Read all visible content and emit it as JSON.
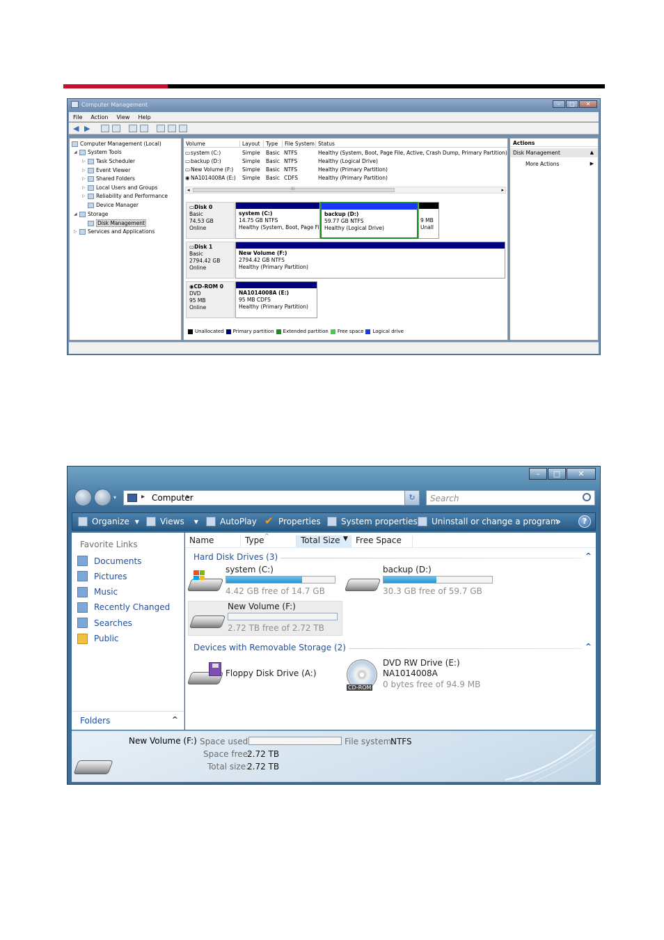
{
  "computer_management": {
    "title": "Computer Management",
    "menu": [
      "File",
      "Action",
      "View",
      "Help"
    ],
    "tree": [
      {
        "label": "Computer Management (Local)",
        "icon": "computer-icon"
      },
      {
        "label": "System Tools",
        "icon": "tools-icon"
      },
      {
        "label": "Task Scheduler",
        "icon": "clock-icon"
      },
      {
        "label": "Event Viewer",
        "icon": "event-viewer-icon"
      },
      {
        "label": "Shared Folders",
        "icon": "shared-folder-icon"
      },
      {
        "label": "Local Users and Groups",
        "icon": "users-icon"
      },
      {
        "label": "Reliability and Performance",
        "icon": "performance-icon"
      },
      {
        "label": "Device Manager",
        "icon": "device-manager-icon"
      },
      {
        "label": "Storage",
        "icon": "storage-icon"
      },
      {
        "label": "Disk Management",
        "icon": "disk-management-icon"
      },
      {
        "label": "Services and Applications",
        "icon": "services-icon"
      }
    ],
    "volume_columns": [
      "Volume",
      "Layout",
      "Type",
      "File System",
      "Status"
    ],
    "volumes": [
      {
        "volume": "system (C:)",
        "layout": "Simple",
        "type": "Basic",
        "fs": "NTFS",
        "status": "Healthy (System, Boot, Page File, Active, Crash Dump, Primary Partition)"
      },
      {
        "volume": "backup (D:)",
        "layout": "Simple",
        "type": "Basic",
        "fs": "NTFS",
        "status": "Healthy (Logical Drive)"
      },
      {
        "volume": "New Volume (F:)",
        "layout": "Simple",
        "type": "Basic",
        "fs": "NTFS",
        "status": "Healthy (Primary Partition)"
      },
      {
        "volume": "NA1014008A (E:)",
        "layout": "Simple",
        "type": "Basic",
        "fs": "CDFS",
        "status": "Healthy (Primary Partition)"
      }
    ],
    "scroll_mark": "III",
    "disks": [
      {
        "name": "Disk 0",
        "type": "Basic",
        "size": "74.53 GB",
        "state": "Online"
      },
      {
        "name": "Disk 1",
        "type": "Basic",
        "size": "2794.42 GB",
        "state": "Online"
      },
      {
        "name": "CD-ROM 0",
        "type": "DVD",
        "size": "95 MB",
        "state": "Online"
      }
    ],
    "partitions": {
      "c": {
        "name": "system  (C:)",
        "size": "14.75 GB NTFS",
        "status": "Healthy (System, Boot, Page Fi"
      },
      "d": {
        "name": "backup  (D:)",
        "size": "59.77 GB NTFS",
        "status": "Healthy (Logical Drive)"
      },
      "unalloc": {
        "size": "9 MB",
        "status": "Unall"
      },
      "f": {
        "name": "New Volume  (F:)",
        "size": "2794.42 GB NTFS",
        "status": "Healthy (Primary Partition)"
      },
      "e": {
        "name": "NA1014008A  (E:)",
        "size": "95 MB CDFS",
        "status": "Healthy (Primary Partition)"
      }
    },
    "legend": [
      {
        "label": "Unallocated",
        "color": "#000000"
      },
      {
        "label": "Primary partition",
        "color": "#00007f"
      },
      {
        "label": "Extended partition",
        "color": "#1b8f1b"
      },
      {
        "label": "Free space",
        "color": "#3fcf3f"
      },
      {
        "label": "Logical drive",
        "color": "#1b37f5"
      }
    ],
    "actions": {
      "header": "Actions",
      "selected": "Disk Management",
      "more": "More Actions"
    }
  },
  "explorer": {
    "address": "Computer",
    "search_placeholder": "Search",
    "commands": {
      "organize": "Organize",
      "views": "Views",
      "autoplay": "AutoPlay",
      "properties": "Properties",
      "system_properties": "System properties",
      "uninstall": "Uninstall or change a program",
      "more": "»"
    },
    "favorite_links_title": "Favorite Links",
    "favorites": [
      {
        "label": "Documents",
        "icon": "documents-icon"
      },
      {
        "label": "Pictures",
        "icon": "pictures-icon"
      },
      {
        "label": "Music",
        "icon": "music-icon"
      },
      {
        "label": "Recently Changed",
        "icon": "recently-changed-icon"
      },
      {
        "label": "Searches",
        "icon": "searches-icon"
      },
      {
        "label": "Public",
        "icon": "public-folder-icon"
      }
    ],
    "folders_label": "Folders",
    "columns": [
      "Name",
      "Type",
      "Total Size",
      "Free Space"
    ],
    "group_hdd": "Hard Disk Drives (3)",
    "group_removable": "Devices with Removable Storage (2)",
    "drives": {
      "c": {
        "name": "system (C:)",
        "free": "4.42 GB free of 14.7 GB",
        "used_fraction": 0.7
      },
      "d": {
        "name": "backup (D:)",
        "free": "30.3 GB free of 59.7 GB",
        "used_fraction": 0.49
      },
      "f": {
        "name": "New Volume (F:)",
        "free": "2.72 TB free of 2.72 TB",
        "used_fraction": 0.0
      },
      "a": {
        "name": "Floppy Disk Drive (A:)"
      },
      "e": {
        "name": "DVD RW Drive (E:)",
        "label": "NA1014008A",
        "free": "0 bytes free of 94.9 MB",
        "badge": "CD-ROM"
      }
    },
    "details": {
      "name": "New Volume (F:)",
      "space_used_label": "Space used:",
      "filesystem_label": "File system:",
      "filesystem": "NTFS",
      "space_free_label": "Space free:",
      "space_free": "2.72 TB",
      "total_size_label": "Total size:",
      "total_size": "2.72 TB"
    }
  }
}
